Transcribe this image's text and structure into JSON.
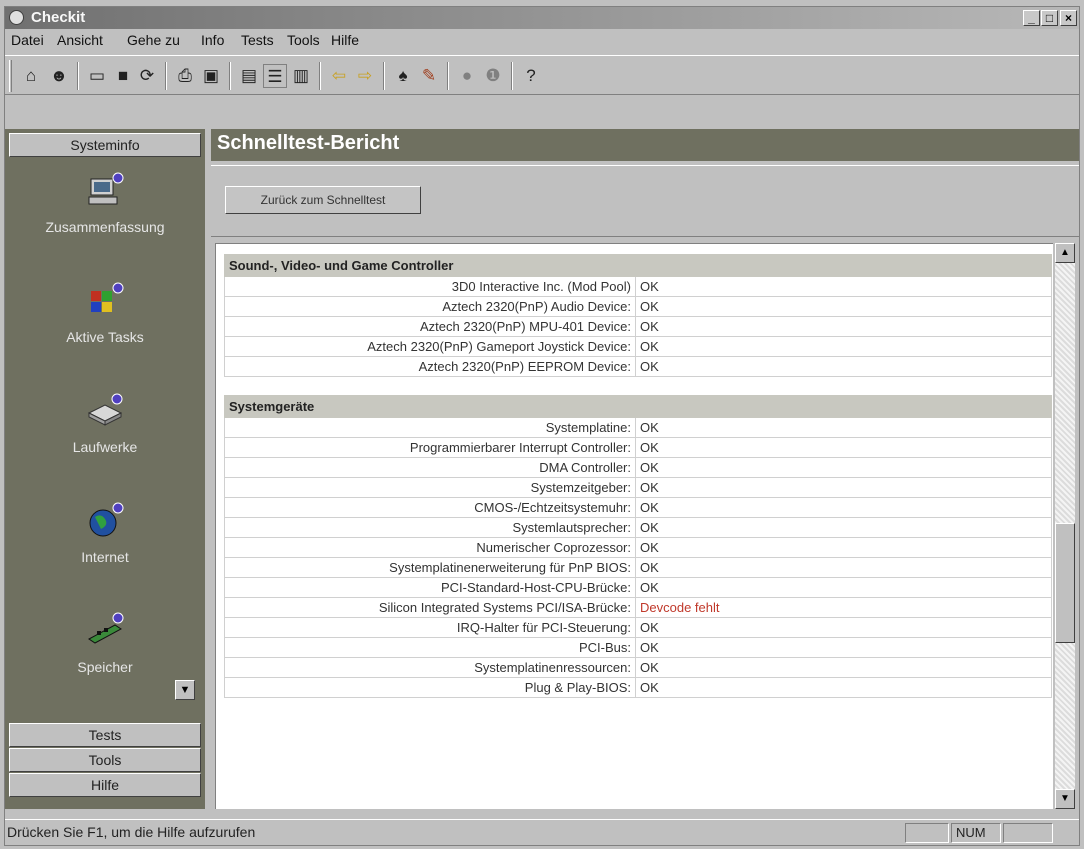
{
  "window": {
    "title": "Checkit",
    "min_icon": "minimize-icon",
    "max_icon": "maximize-icon",
    "close_icon": "close-icon"
  },
  "menu": [
    "Datei",
    "Ansicht",
    "Gehe zu",
    "Info",
    "Tests",
    "Tools",
    "Hilfe"
  ],
  "toolbar_icons": [
    "home-icon",
    "user-icon",
    "open-folder-icon",
    "save-icon",
    "refresh-icon",
    "print-icon",
    "preview-icon",
    "view-large-icon",
    "view-list-icon",
    "view-details-icon",
    "back-arrow-icon",
    "forward-arrow-icon",
    "find-icon",
    "tools-icon",
    "stop-icon",
    "info-icon",
    "help-icon"
  ],
  "sidebar": {
    "section_title": "Systeminfo",
    "items": [
      {
        "label": "Zusammenfassung",
        "icon": "computer-icon"
      },
      {
        "label": "Aktive Tasks",
        "icon": "tasks-icon"
      },
      {
        "label": "Laufwerke",
        "icon": "drive-icon"
      },
      {
        "label": "Internet",
        "icon": "globe-icon"
      },
      {
        "label": "Speicher",
        "icon": "memory-icon"
      }
    ],
    "tabs": [
      "Tests",
      "Tools",
      "Hilfe"
    ]
  },
  "main": {
    "title": "Schnelltest-Bericht",
    "back_button": "Zurück zum Schnelltest",
    "sections": [
      {
        "title": "Sound-, Video- und Game Controller",
        "rows": [
          {
            "label": "3D0 Interactive Inc. (Mod Pool)",
            "value": "OK"
          },
          {
            "label": "Aztech 2320(PnP) Audio Device:",
            "value": "OK"
          },
          {
            "label": "Aztech 2320(PnP) MPU-401 Device:",
            "value": "OK"
          },
          {
            "label": "Aztech 2320(PnP) Gameport Joystick Device:",
            "value": "OK"
          },
          {
            "label": "Aztech 2320(PnP) EEPROM Device:",
            "value": "OK"
          }
        ]
      },
      {
        "title": "Systemgeräte",
        "rows": [
          {
            "label": "Systemplatine:",
            "value": "OK"
          },
          {
            "label": "Programmierbarer Interrupt Controller:",
            "value": "OK"
          },
          {
            "label": "DMA Controller:",
            "value": "OK"
          },
          {
            "label": "Systemzeitgeber:",
            "value": "OK"
          },
          {
            "label": "CMOS-/Echtzeitsystemuhr:",
            "value": "OK"
          },
          {
            "label": "Systemlautsprecher:",
            "value": "OK"
          },
          {
            "label": "Numerischer Coprozessor:",
            "value": "OK"
          },
          {
            "label": "Systemplatinenerweiterung für PnP BIOS:",
            "value": "OK"
          },
          {
            "label": "PCI-Standard-Host-CPU-Brücke:",
            "value": "OK"
          },
          {
            "label": "Silicon Integrated Systems PCI/ISA-Brücke:",
            "value": "Devcode fehlt",
            "status": "error"
          },
          {
            "label": "IRQ-Halter für PCI-Steuerung:",
            "value": "OK"
          },
          {
            "label": "PCI-Bus:",
            "value": "OK"
          },
          {
            "label": "Systemplatinenressourcen:",
            "value": "OK"
          },
          {
            "label": "Plug & Play-BIOS:",
            "value": "OK"
          }
        ]
      }
    ]
  },
  "status": {
    "text": "Drücken Sie F1, um die Hilfe aufzurufen",
    "num": "NUM"
  },
  "colors": {
    "sidebar_bg": "#6f7060",
    "error_text": "#c0392b",
    "section_bg": "#c8c8c0"
  }
}
